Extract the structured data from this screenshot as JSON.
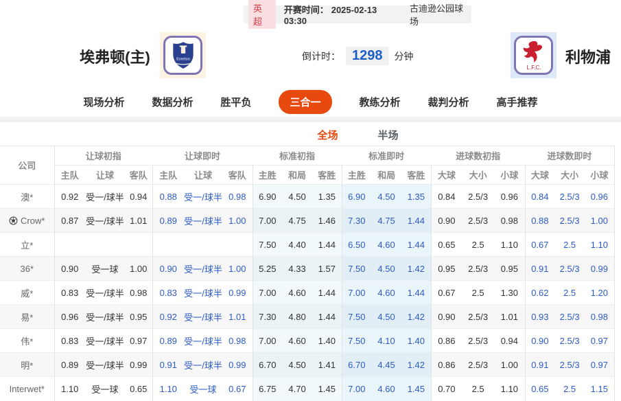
{
  "header_bar": {
    "league": "英超",
    "kickoff_label": "开赛时间：",
    "kickoff_time": "2025-02-13 03:30",
    "venue": "古迪逊公园球场"
  },
  "match": {
    "home": {
      "name": "埃弗顿(主)",
      "badge_text": "Everton"
    },
    "away": {
      "name": "利物浦",
      "badge_text": "L.F.C."
    },
    "countdown": {
      "label": "倒计时：",
      "value": "1298",
      "unit": "分钟"
    }
  },
  "nav": {
    "items": [
      {
        "label": "现场分析",
        "active": false
      },
      {
        "label": "数据分析",
        "active": false
      },
      {
        "label": "胜平负",
        "active": false
      },
      {
        "label": "三合一",
        "active": true
      },
      {
        "label": "教练分析",
        "active": false
      },
      {
        "label": "裁判分析",
        "active": false
      },
      {
        "label": "高手推荐",
        "active": false
      }
    ]
  },
  "subtabs": {
    "items": [
      {
        "label": "全场",
        "active": true
      },
      {
        "label": "半场",
        "active": false
      }
    ]
  },
  "table": {
    "company_header": "公司",
    "groups": [
      {
        "label": "让球初指",
        "cols": [
          "主队",
          "让球",
          "客队"
        ],
        "style": "init"
      },
      {
        "label": "让球即时",
        "cols": [
          "主队",
          "让球",
          "客队"
        ],
        "style": "live"
      },
      {
        "label": "标准初指",
        "cols": [
          "主胜",
          "和局",
          "客胜"
        ],
        "style": "std-init"
      },
      {
        "label": "标准即时",
        "cols": [
          "主胜",
          "和局",
          "客胜"
        ],
        "style": "std-live"
      },
      {
        "label": "进球数初指",
        "cols": [
          "大球",
          "大小",
          "小球"
        ],
        "style": "init"
      },
      {
        "label": "进球数即时",
        "cols": [
          "大球",
          "大小",
          "小球"
        ],
        "style": "live"
      }
    ],
    "rows": [
      {
        "company": "澳*",
        "icon": null,
        "cells": [
          "0.92",
          "受一/球半",
          "0.94",
          "0.88",
          "受一/球半",
          "0.98",
          "6.90",
          "4.50",
          "1.35",
          "6.90",
          "4.50",
          "1.35",
          "0.84",
          "2.5/3",
          "0.96",
          "0.84",
          "2.5/3",
          "0.96"
        ]
      },
      {
        "company": "Crow*",
        "icon": "soccer-ball-icon",
        "cells": [
          "0.87",
          "受一/球半",
          "1.01",
          "0.89",
          "受一/球半",
          "1.00",
          "7.00",
          "4.75",
          "1.46",
          "7.30",
          "4.75",
          "1.44",
          "0.90",
          "2.5/3",
          "0.98",
          "0.88",
          "2.5/3",
          "1.00"
        ]
      },
      {
        "company": "立*",
        "icon": null,
        "cells": [
          "",
          "",
          "",
          "",
          "",
          "",
          "7.50",
          "4.40",
          "1.44",
          "6.50",
          "4.60",
          "1.44",
          "0.65",
          "2.5",
          "1.10",
          "0.67",
          "2.5",
          "1.10"
        ]
      },
      {
        "company": "36*",
        "icon": null,
        "cells": [
          "0.90",
          "受一球",
          "1.00",
          "0.90",
          "受一/球半",
          "1.00",
          "5.25",
          "4.33",
          "1.57",
          "7.50",
          "4.50",
          "1.42",
          "0.95",
          "2.5/3",
          "0.95",
          "0.91",
          "2.5/3",
          "0.99"
        ]
      },
      {
        "company": "威*",
        "icon": null,
        "cells": [
          "0.83",
          "受一/球半",
          "0.98",
          "0.83",
          "受一/球半",
          "0.99",
          "7.00",
          "4.60",
          "1.44",
          "7.00",
          "4.60",
          "1.44",
          "0.67",
          "2.5",
          "1.30",
          "0.62",
          "2.5",
          "1.20"
        ]
      },
      {
        "company": "易*",
        "icon": null,
        "cells": [
          "0.96",
          "受一/球半",
          "0.95",
          "0.92",
          "受一/球半",
          "1.01",
          "7.30",
          "4.80",
          "1.44",
          "7.50",
          "4.50",
          "1.42",
          "0.90",
          "2.5/3",
          "1.01",
          "0.93",
          "2.5/3",
          "0.98"
        ]
      },
      {
        "company": "伟*",
        "icon": null,
        "cells": [
          "0.83",
          "受一/球半",
          "0.97",
          "0.89",
          "受一/球半",
          "0.98",
          "7.00",
          "4.60",
          "1.40",
          "7.50",
          "4.10",
          "1.40",
          "0.86",
          "2.5/3",
          "0.94",
          "0.90",
          "2.5/3",
          "0.97"
        ]
      },
      {
        "company": "明*",
        "icon": null,
        "cells": [
          "0.89",
          "受一/球半",
          "0.99",
          "0.91",
          "受一/球半",
          "0.99",
          "6.70",
          "4.50",
          "1.41",
          "6.70",
          "4.45",
          "1.42",
          "0.86",
          "2.5/3",
          "1.00",
          "0.91",
          "2.5/3",
          "0.97"
        ]
      },
      {
        "company": "Interwet*",
        "icon": null,
        "cells": [
          "1.10",
          "受一球",
          "0.65",
          "1.10",
          "受一球",
          "0.67",
          "6.75",
          "4.70",
          "1.45",
          "7.00",
          "4.60",
          "1.45",
          "0.70",
          "2.5",
          "1.10",
          "0.65",
          "2.5",
          "1.15"
        ]
      }
    ]
  },
  "colors": {
    "accent": "#e8490f",
    "odds_blue": "#2c5bc7",
    "league_red": "#d8414b"
  }
}
